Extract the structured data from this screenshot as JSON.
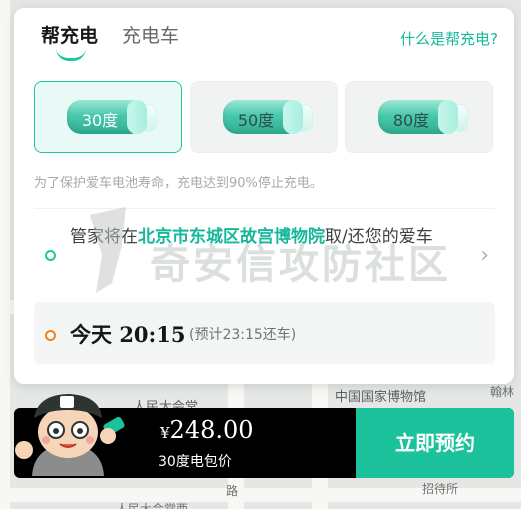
{
  "map": {
    "labels": [
      "中国国家博物馆",
      "人民大会堂",
      "翰林",
      "路",
      "招待所",
      "人民大会堂西"
    ]
  },
  "tabs": [
    {
      "label": "帮充电",
      "active": true
    },
    {
      "label": "充电车",
      "active": false
    }
  ],
  "help_link": "什么是帮充电?",
  "charge_options": [
    {
      "label": "30度",
      "selected": true
    },
    {
      "label": "50度",
      "selected": false
    },
    {
      "label": "80度",
      "selected": false
    }
  ],
  "notice": "为了保护爱车电池寿命，充电达到90%停止充电。",
  "address": {
    "prefix": "管家将在",
    "location": "北京市东城区故宫博物院",
    "suffix": "取/还您的爱车",
    "chevron_icon": "chevron-right-icon"
  },
  "time": {
    "day": "今天",
    "clock": "20:15",
    "return_note": "(预计23:15还车)"
  },
  "watermark": "奇安信攻防社区",
  "checkout": {
    "currency": "¥",
    "price": "248.00",
    "description": "30度电包价",
    "book_label": "立即预约"
  },
  "colors": {
    "accent": "#1ac7a0",
    "accent_text": "#15b99a",
    "orange": "#f0821d"
  }
}
